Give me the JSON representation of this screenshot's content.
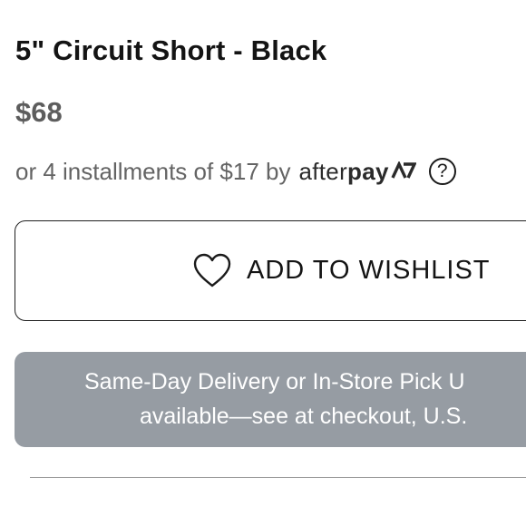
{
  "product": {
    "title": "5\" Circuit Short - Black",
    "price": "$68"
  },
  "installments": {
    "text": "or 4 installments of $17 by",
    "logo_after": "after",
    "logo_pay": "pay",
    "logo_mark_icon": "afterpay-arrows-icon",
    "help_icon": "question-circle-icon",
    "help_glyph": "?"
  },
  "wishlist": {
    "icon": "heart-icon",
    "label": "ADD TO WISHLIST"
  },
  "delivery": {
    "line1": "Same-Day Delivery or In-Store Pick U",
    "line2": "available—see at checkout, U.S.",
    "background_color": "#969ca3"
  }
}
